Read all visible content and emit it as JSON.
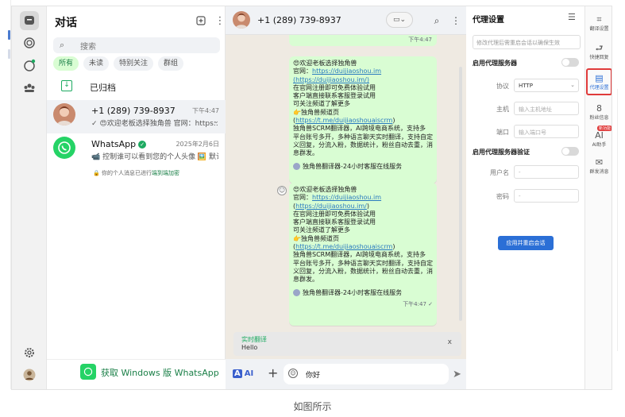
{
  "chatlist": {
    "title": "对话",
    "search_placeholder": "搜索",
    "chips": [
      "所有",
      "未读",
      "特别关注",
      "群组"
    ],
    "archived_label": "已归档",
    "chats": [
      {
        "name": "+1 (289) 739-8937",
        "time": "下午4:47",
        "preview": "✓ 😍欢迎老板选择独角兽 官网：https:..."
      },
      {
        "name": "WhatsApp",
        "time": "2025年2月6日",
        "preview": "📹 控制谁可以看到您的个人头像 🖼️ 默认情..."
      }
    ],
    "privacy_prefix": "🔒 你的个人消息已进行",
    "privacy_link": "端到端加密",
    "get_windows": "获取 Windows 版 WhatsApp"
  },
  "chat": {
    "header_name": "+1 (289) 739-8937",
    "top_time": "下午4:47",
    "msg1": {
      "l1": "😍欢迎老板选择独角兽",
      "l2": "官网：",
      "link1": "https://duijiaoshou.im",
      "link1b": "(https://duijiaoshou.im/)",
      "l3": "在官网注册即可免费体验试用",
      "l4": "客户端直接联系客服登录试用",
      "l5": "可关注频道了解更多",
      "l6": "👉独角兽频道页 (",
      "link2": "https://t.me/duijiaoshouaiscrm",
      "l6b": ")",
      "l7": "独角兽SCRM翻译器，AI跨境电商系统，支持多",
      "l8": "平台账号多开，多种语言聊天实时翻译，支持自定",
      "l9": "义回复，分流入粉，数据统计，粉丝自动去重，消",
      "l10": "息群发。",
      "sig": "独角兽翻译器-24小时客服在线服务"
    },
    "msg2": {
      "l1": "😍欢迎老板选择独角兽",
      "l2": "官网：",
      "link1": "https://duijiaoshou.im",
      "link1b": "https://duijiaoshou.im/",
      "l3": "在官网注册即可免费体验试用",
      "l4": "客户端直接联系客服登录试用",
      "l5": "可关注频道了解更多",
      "l6": "👉独角兽频道页",
      "link2": "https://t.me/duijiaoshouaiscrm",
      "l7": "独角兽SCRM翻译器，AI跨境电商系统，支持多",
      "l8": "平台账号多开，多种语言聊天实时翻译，支持自定",
      "l9": "义回复，分流入粉，数据统计，粉丝自动去重，消",
      "l10": "息群发。",
      "sig": "独角兽翻译器-24小时客服在线服务",
      "time": "下午4:47 ✓"
    },
    "reply_title": "实时翻译",
    "reply_text": "Hello",
    "reply_close": "x",
    "composer_value": "你好",
    "tr_label": "A",
    "ai_label": "AI"
  },
  "proxy": {
    "title": "代理设置",
    "note": "修改代理后需重启会话以确保生效",
    "enable_label": "启用代理服务器",
    "protocol_label": "协议",
    "protocol_value": "HTTP",
    "host_label": "主机",
    "host_placeholder": "输入主机地址",
    "port_label": "端口",
    "port_placeholder": "输入端口号",
    "auth_label": "启用代理服务器验证",
    "user_label": "用户名",
    "user_placeholder": "-",
    "pass_label": "密码",
    "pass_placeholder": "-",
    "apply_label": "应用并重启会话"
  },
  "rrail": [
    {
      "icon": "translate-settings-icon",
      "label": "翻译设置"
    },
    {
      "icon": "quick-reply-icon",
      "label": "快捷回复"
    },
    {
      "icon": "proxy-settings-icon",
      "label": "代理设置"
    },
    {
      "icon": "fan-info-icon",
      "label": "粉丝信息"
    },
    {
      "icon": "ai-assistant-icon",
      "label": "AI助手",
      "badge": "新功能"
    },
    {
      "icon": "broadcast-icon",
      "label": "群发消息"
    }
  ],
  "caption": "如图所示",
  "colors": {
    "accent_green": "#1daa61",
    "bubble": "#d9fdd3",
    "primary_blue": "#2b6fd6",
    "highlight_red": "#e03b3b"
  }
}
